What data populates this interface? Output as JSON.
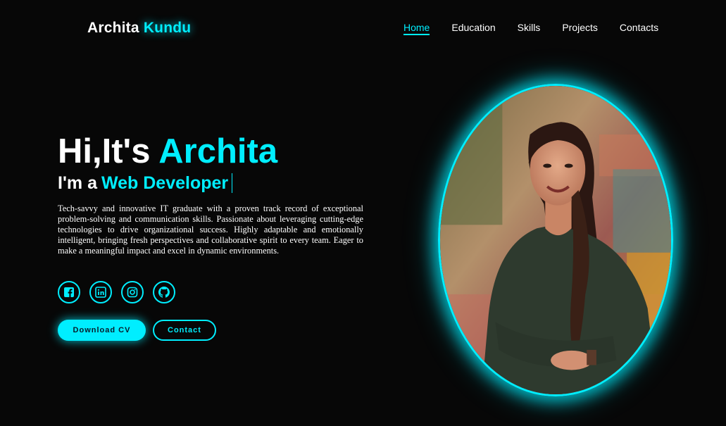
{
  "header": {
    "logo_first": "Archita",
    "logo_last": "Kundu",
    "nav": [
      "Home",
      "Education",
      "Skills",
      "Projects",
      "Contacts"
    ],
    "active_nav": "Home"
  },
  "hero": {
    "greeting": "Hi,It's",
    "name": "Archita",
    "role_prefix": "I'm a",
    "role": "Web Developer",
    "bio": "Tech-savvy and innovative IT graduate with a proven track record of exceptional problem-solving and communication skills. Passionate about leveraging cutting-edge technologies to drive organizational success. Highly adaptable and emotionally intelligent, bringing fresh perspectives and collaborative spirit to every team. Eager to make a meaningful impact and excel in dynamic environments."
  },
  "socials": [
    {
      "icon": "facebook-icon"
    },
    {
      "icon": "linkedin-icon"
    },
    {
      "icon": "instagram-icon"
    },
    {
      "icon": "github-icon"
    }
  ],
  "buttons": {
    "download_cv": "Download CV",
    "contact": "Contact"
  },
  "colors": {
    "accent": "#00eeff",
    "background": "#070707",
    "text": "#ffffff"
  }
}
